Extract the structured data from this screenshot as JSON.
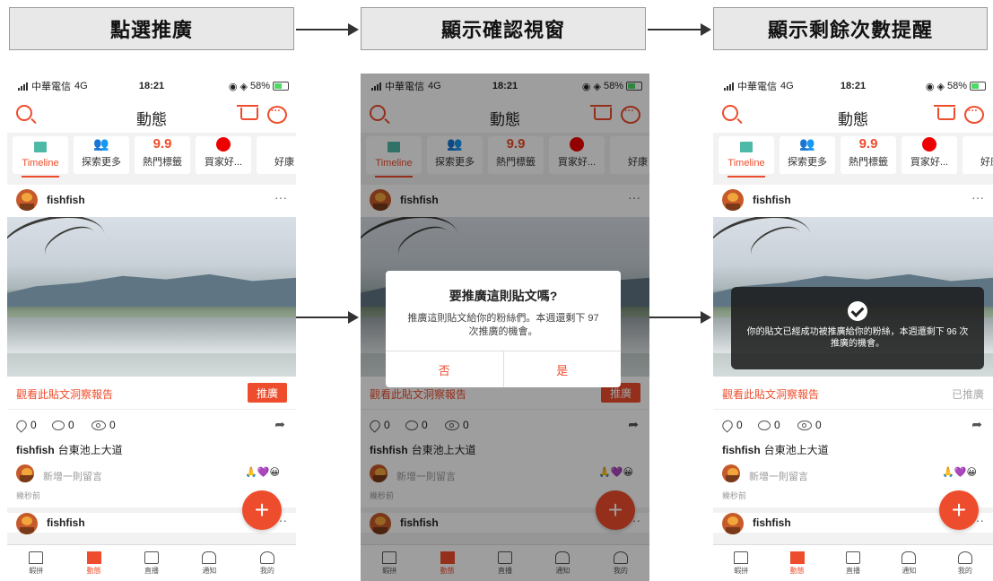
{
  "steps": [
    {
      "label": "點選推廣"
    },
    {
      "label": "顯示確認視窗"
    },
    {
      "label": "顯示剩餘次數提醒"
    }
  ],
  "phone": {
    "carrier": "中華電信",
    "network": "4G",
    "time": "18:21",
    "battery": "58%",
    "header_title": "動態",
    "icons": {
      "search": "search-icon",
      "cart": "cart-icon",
      "chat": "chat-icon"
    },
    "tabs": [
      "Timeline",
      "探索更多",
      "熱門標籤",
      "買家好...",
      "好康"
    ],
    "tab_icon_99": "9.9",
    "post_user": "fishfish",
    "more": "···",
    "insight_link": "觀看此貼文洞察報告",
    "promote_label": "推廣",
    "promoted_label": "已推廣",
    "likes": "0",
    "comments": "0",
    "views": "0",
    "caption_user": "fishfish",
    "caption_text": "台東池上大道",
    "add_comment": "新增一則留言",
    "time_ago": "幾秒前",
    "emojis": "🙏💜😀",
    "fab": "+",
    "next_post_user": "fishfish",
    "bottom_tabs": [
      "蝦拼",
      "動態",
      "直播",
      "通知",
      "我的"
    ]
  },
  "dialog": {
    "title": "要推廣這則貼文嗎?",
    "body": "推廣這則貼文給你的粉絲們。本週還剩下 97 次推廣的機會。",
    "no": "否",
    "yes": "是"
  },
  "toast": {
    "text": "你的貼文已經成功被推廣給你的粉絲，本週還剩下 96 次推廣的機會。"
  },
  "colors": {
    "accent": "#ee4d2d"
  }
}
